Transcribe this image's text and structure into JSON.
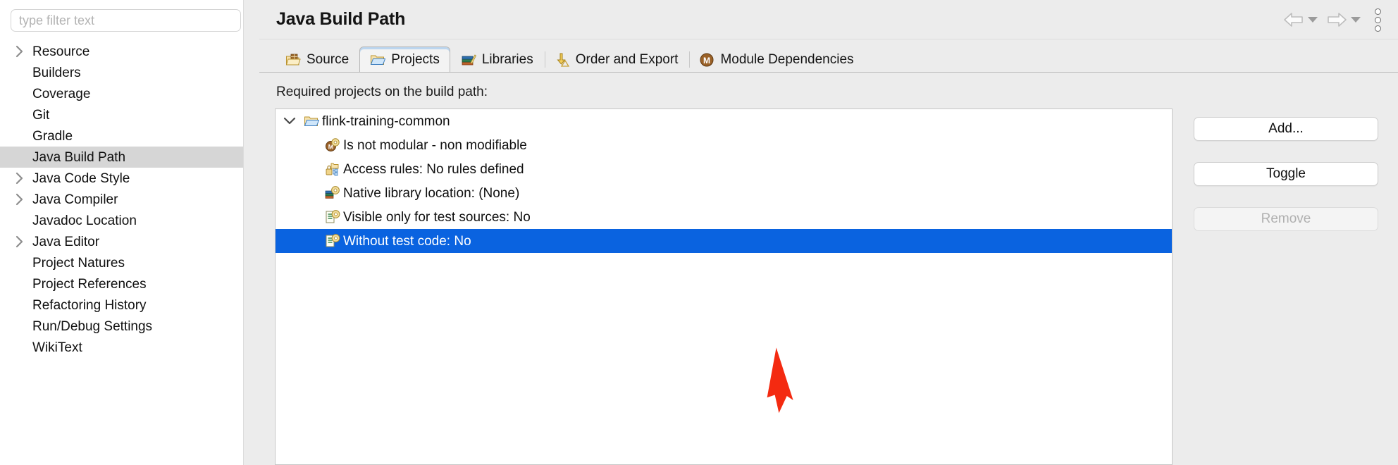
{
  "sidebar": {
    "filter": {
      "placeholder": "type filter text",
      "value": ""
    },
    "items": [
      {
        "label": "Resource",
        "expandable": true,
        "selected": false
      },
      {
        "label": "Builders",
        "expandable": false,
        "selected": false
      },
      {
        "label": "Coverage",
        "expandable": false,
        "selected": false
      },
      {
        "label": "Git",
        "expandable": false,
        "selected": false
      },
      {
        "label": "Gradle",
        "expandable": false,
        "selected": false
      },
      {
        "label": "Java Build Path",
        "expandable": false,
        "selected": true
      },
      {
        "label": "Java Code Style",
        "expandable": true,
        "selected": false
      },
      {
        "label": "Java Compiler",
        "expandable": true,
        "selected": false
      },
      {
        "label": "Javadoc Location",
        "expandable": false,
        "selected": false
      },
      {
        "label": "Java Editor",
        "expandable": true,
        "selected": false
      },
      {
        "label": "Project Natures",
        "expandable": false,
        "selected": false
      },
      {
        "label": "Project References",
        "expandable": false,
        "selected": false
      },
      {
        "label": "Refactoring History",
        "expandable": false,
        "selected": false
      },
      {
        "label": "Run/Debug Settings",
        "expandable": false,
        "selected": false
      },
      {
        "label": "WikiText",
        "expandable": false,
        "selected": false
      }
    ]
  },
  "header": {
    "title": "Java Build Path",
    "back_icon": "back-arrow-icon",
    "forward_icon": "forward-arrow-icon",
    "menu_icon": "vertical-ellipsis-icon"
  },
  "tabs": [
    {
      "label": "Source",
      "icon": "source-folder-icon",
      "active": false
    },
    {
      "label": "Projects",
      "icon": "projects-folder-icon",
      "active": true
    },
    {
      "label": "Libraries",
      "icon": "libraries-books-icon",
      "active": false
    },
    {
      "label": "Order and Export",
      "icon": "order-export-arrow-icon",
      "active": false
    },
    {
      "label": "Module Dependencies",
      "icon": "module-m-icon",
      "active": false
    }
  ],
  "main": {
    "description": "Required projects on the build path:",
    "tree": [
      {
        "label": "flink-training-common",
        "icon": "open-folder-icon",
        "level": 0,
        "expanded": true,
        "selected": false
      },
      {
        "label": "Is not modular - non modifiable",
        "icon": "module-gear-icon",
        "level": 1,
        "selected": false
      },
      {
        "label": "Access rules: No rules defined",
        "icon": "access-rules-lock-icon",
        "level": 1,
        "selected": false
      },
      {
        "label": "Native library location: (None)",
        "icon": "native-library-gear-icon",
        "level": 1,
        "selected": false
      },
      {
        "label": "Visible only for test sources: No",
        "icon": "test-sources-gear-icon",
        "level": 1,
        "selected": false
      },
      {
        "label": "Without test code: No",
        "icon": "test-code-gear-icon",
        "level": 1,
        "selected": true
      }
    ],
    "buttons": [
      {
        "label": "Add...",
        "enabled": true
      },
      {
        "label": "Toggle",
        "enabled": true
      },
      {
        "label": "Remove",
        "enabled": false
      }
    ]
  },
  "annotation": {
    "type": "red-arrow",
    "color": "#f42a10",
    "points_at": "Without test code: No"
  },
  "colors": {
    "selection_blue": "#0a63e0",
    "sidebar_selection": "#d6d6d6",
    "chrome_gray": "#ececec",
    "annotation_red": "#f42a10"
  }
}
